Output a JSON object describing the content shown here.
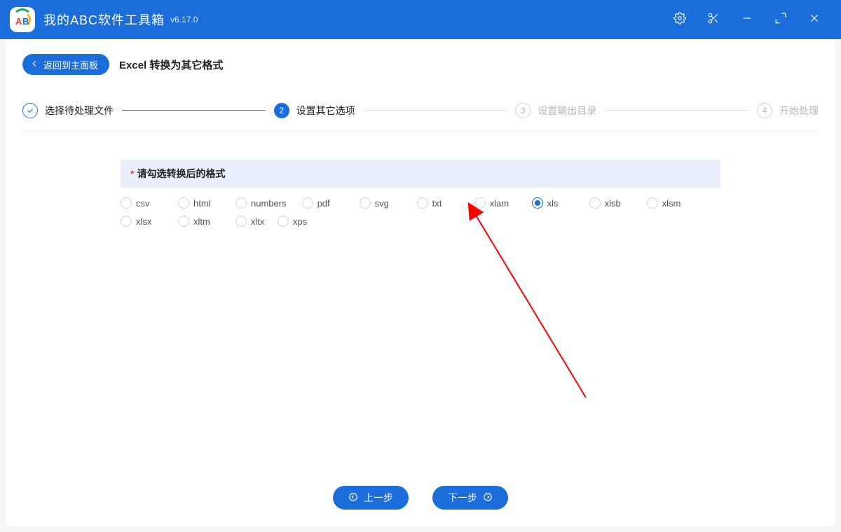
{
  "app": {
    "title": "我的ABC软件工具箱",
    "version": "v6.17.0"
  },
  "page": {
    "back_label": "返回到主面板",
    "title": "Excel 转换为其它格式"
  },
  "stepper": {
    "s1": {
      "label": "选择待处理文件",
      "status": "done"
    },
    "s2": {
      "label": "设置其它选项",
      "num": "2",
      "status": "active"
    },
    "s3": {
      "label": "设置输出目录",
      "num": "3",
      "status": "pending"
    },
    "s4": {
      "label": "开始处理",
      "num": "4",
      "status": "pending"
    }
  },
  "section": {
    "required_mark": "*",
    "title": "请勾选转换后的格式"
  },
  "formats": {
    "selected": "xls",
    "items": [
      "csv",
      "html",
      "numbers",
      "pdf",
      "svg",
      "txt",
      "xlam",
      "xls",
      "xlsb",
      "xlsm",
      "xlsx",
      "xltm",
      "xltx",
      "xps"
    ]
  },
  "footer": {
    "prev": "上一步",
    "next": "下一步"
  }
}
